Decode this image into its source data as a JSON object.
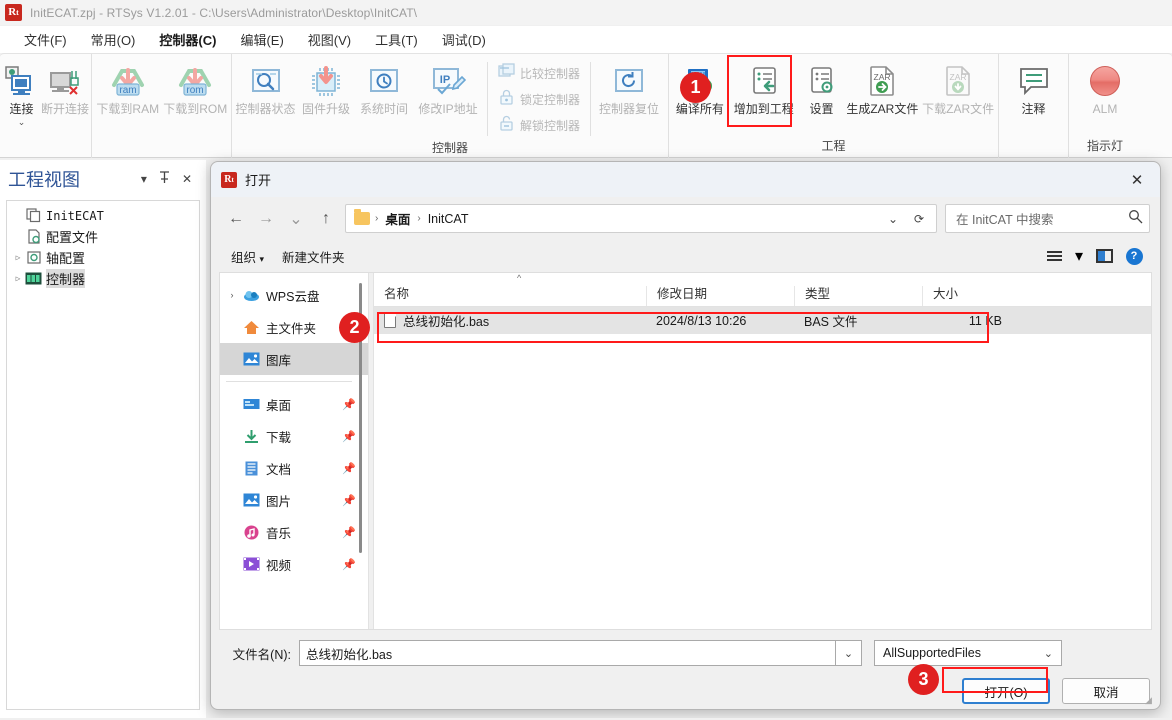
{
  "window": {
    "app_icon": "rt-logo-icon",
    "title": "InitECAT.zpj - RTSys V1.2.01 - C:\\Users\\Administrator\\Desktop\\InitCAT\\"
  },
  "menubar": {
    "items": [
      {
        "label": "文件(F)",
        "active": false
      },
      {
        "label": "常用(O)",
        "active": false
      },
      {
        "label": "控制器(C)",
        "active": true
      },
      {
        "label": "编辑(E)",
        "active": false
      },
      {
        "label": "视图(V)",
        "active": false
      },
      {
        "label": "工具(T)",
        "active": false
      },
      {
        "label": "调试(D)",
        "active": false
      }
    ]
  },
  "ribbon": {
    "groups": [
      {
        "title": "",
        "buttons": [
          {
            "label": "连接",
            "icon": "connect-monitor-icon",
            "disabled": false,
            "dropdown": true
          },
          {
            "label": "断开连接",
            "icon": "disconnect-monitor-icon",
            "disabled": true,
            "dropdown": false
          }
        ]
      },
      {
        "title": "",
        "buttons": [
          {
            "label": "下载到RAM",
            "icon": "download-ram-icon",
            "disabled": true,
            "dropdown": false
          },
          {
            "label": "下载到ROM",
            "icon": "download-rom-icon",
            "disabled": true,
            "dropdown": false
          }
        ]
      },
      {
        "title": "控制器",
        "buttons": [
          {
            "label": "控制器状态",
            "icon": "controller-status-icon",
            "disabled": true,
            "dropdown": false
          },
          {
            "label": "固件升级",
            "icon": "firmware-upgrade-icon",
            "disabled": true,
            "dropdown": false
          },
          {
            "label": "系统时间",
            "icon": "system-time-icon",
            "disabled": true,
            "dropdown": false
          },
          {
            "label": "修改IP地址",
            "icon": "edit-ip-icon",
            "disabled": true,
            "dropdown": false
          }
        ],
        "small_buttons": [
          {
            "label": "比较控制器",
            "icon": "compare-controller-icon",
            "disabled": true
          },
          {
            "label": "锁定控制器",
            "icon": "lock-controller-icon",
            "disabled": true
          },
          {
            "label": "解锁控制器",
            "icon": "unlock-controller-icon",
            "disabled": true
          }
        ],
        "extra_buttons": [
          {
            "label": "控制器复位",
            "icon": "controller-reset-icon",
            "disabled": true
          }
        ]
      },
      {
        "title": "工程",
        "buttons": [
          {
            "label": "编译所有",
            "icon": "compile-all-icon",
            "disabled": false,
            "dropdown": false
          },
          {
            "label": "增加到工程",
            "icon": "add-to-project-icon",
            "disabled": false,
            "dropdown": false,
            "highlighted": true
          },
          {
            "label": "设置",
            "icon": "settings-icon",
            "disabled": false,
            "dropdown": false
          },
          {
            "label": "生成ZAR文件",
            "icon": "generate-zar-icon",
            "disabled": false,
            "dropdown": false
          },
          {
            "label": "下载ZAR文件",
            "icon": "download-zar-icon",
            "disabled": true,
            "dropdown": false
          }
        ]
      },
      {
        "title": "",
        "buttons": [
          {
            "label": "注释",
            "icon": "comment-icon",
            "disabled": false,
            "dropdown": false
          }
        ]
      },
      {
        "title": "指示灯",
        "buttons": [
          {
            "label": "ALM",
            "icon": "alarm-led-icon",
            "disabled": true,
            "dropdown": false
          }
        ]
      }
    ]
  },
  "project_view": {
    "title": "工程视图",
    "tools": [
      {
        "name": "dropdown-icon",
        "glyph": "▾"
      },
      {
        "name": "pin-icon",
        "glyph": "⇟"
      },
      {
        "name": "close-icon",
        "glyph": "✕"
      }
    ],
    "tree": [
      {
        "label": "InitECAT",
        "icon": "project-icon",
        "expander": "",
        "selected": false,
        "mono": true
      },
      {
        "label": "配置文件",
        "icon": "config-file-icon",
        "expander": "",
        "selected": false,
        "mono": false
      },
      {
        "label": "轴配置",
        "icon": "axis-config-icon",
        "expander": "▷",
        "selected": false,
        "mono": false
      },
      {
        "label": "控制器",
        "icon": "controller-node-icon",
        "expander": "▷",
        "selected": true,
        "mono": false
      }
    ]
  },
  "dialog": {
    "icon": "rt-logo-icon",
    "title": "打开",
    "close_label": "✕",
    "nav_buttons": [
      {
        "name": "back-button",
        "glyph": "←",
        "dim": false
      },
      {
        "name": "forward-button",
        "glyph": "→",
        "dim": true
      },
      {
        "name": "recent-locations-button",
        "glyph": "⌄",
        "dim": true
      },
      {
        "name": "up-button",
        "glyph": "↑",
        "dim": false
      }
    ],
    "address": {
      "folder_icon": "folder-icon",
      "crumbs": [
        "桌面",
        "InitCAT"
      ],
      "dropdown_glyph": "⌄",
      "refresh_glyph": "⟳"
    },
    "search": {
      "placeholder": "在 InitCAT 中搜索",
      "icon": "search-icon"
    },
    "toolbar": {
      "organize_label": "组织",
      "organize_caret": "▾",
      "new_folder_label": "新建文件夹",
      "view_icon": "list-view-icon",
      "view_caret": "▾",
      "preview_icon": "preview-pane-icon",
      "help_icon": "help-icon",
      "help_glyph": "?"
    },
    "nav_pane": {
      "items": [
        {
          "label": "WPS云盘",
          "icon": "cloud-icon",
          "chevron": "›",
          "selected": false,
          "pinned": false
        },
        {
          "label": "主文件夹",
          "icon": "home-icon",
          "chevron": "",
          "selected": false,
          "pinned": false
        },
        {
          "label": "图库",
          "icon": "gallery-icon",
          "chevron": "",
          "selected": true,
          "pinned": false
        },
        {
          "separator": true
        },
        {
          "label": "桌面",
          "icon": "desktop-icon",
          "chevron": "",
          "selected": false,
          "pinned": true
        },
        {
          "label": "下载",
          "icon": "downloads-icon",
          "chevron": "",
          "selected": false,
          "pinned": true
        },
        {
          "label": "文档",
          "icon": "documents-icon",
          "chevron": "",
          "selected": false,
          "pinned": true
        },
        {
          "label": "图片",
          "icon": "pictures-icon",
          "chevron": "",
          "selected": false,
          "pinned": true
        },
        {
          "label": "音乐",
          "icon": "music-icon",
          "chevron": "",
          "selected": false,
          "pinned": true
        },
        {
          "label": "视频",
          "icon": "videos-icon",
          "chevron": "",
          "selected": false,
          "pinned": true
        }
      ]
    },
    "file_list": {
      "sort_caret": "^",
      "columns": [
        "名称",
        "修改日期",
        "类型",
        "大小"
      ],
      "rows": [
        {
          "name": "总线初始化.bas",
          "date": "2024/8/13 10:26",
          "type": "BAS 文件",
          "size": "11 KB",
          "icon": "file-icon",
          "selected": true
        }
      ]
    },
    "footer": {
      "filename_label": "文件名(N):",
      "filename_value": "总线初始化.bas",
      "filename_dropdown": "⌄",
      "filter_value": "AllSupportedFiles",
      "filter_caret": "⌄",
      "open_button": "打开(O)",
      "cancel_button": "取消"
    }
  },
  "annotations": {
    "badges": [
      {
        "number": "1",
        "target": "add-to-project-ribbon-button"
      },
      {
        "number": "2",
        "target": "file-row-highlight"
      },
      {
        "number": "3",
        "target": "open-button"
      }
    ],
    "highlight_color": "#ff1a1a"
  }
}
